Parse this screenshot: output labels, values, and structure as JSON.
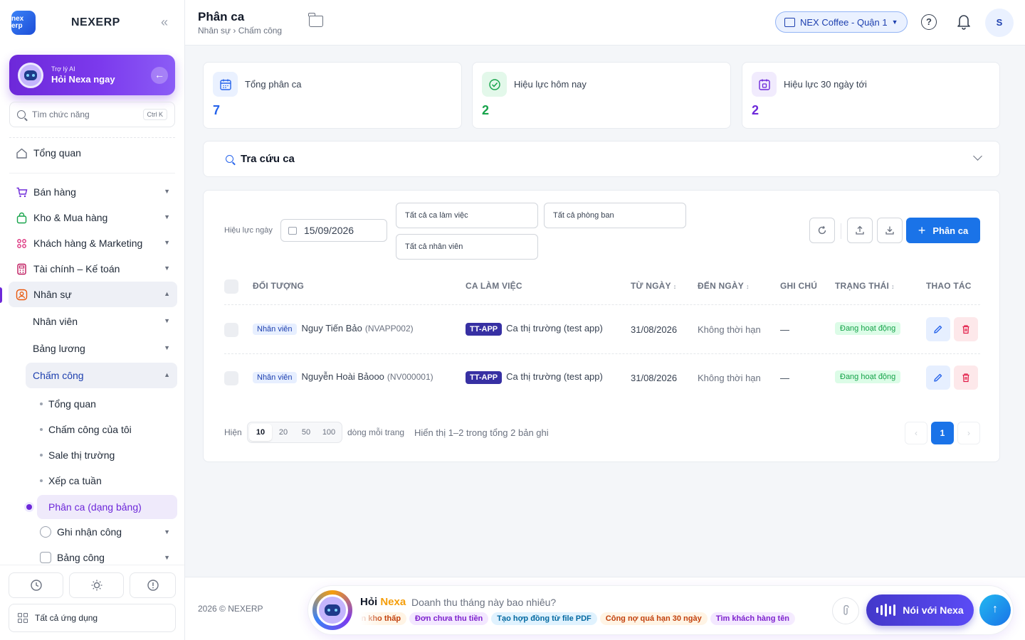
{
  "sidebar": {
    "brand_logo_text": "nex erp",
    "brand_name": "NEXERP",
    "collapse_icon": "«",
    "ai": {
      "sub": "Trợ lý AI",
      "title": "Hỏi Nexa ngay"
    },
    "search": {
      "placeholder": "Tìm chức năng",
      "shortcut": "Ctrl K"
    },
    "overview": "Tổng quan",
    "sections": [
      {
        "label": "Bán hàng",
        "icon": "cart-icon"
      },
      {
        "label": "Kho & Mua hàng",
        "icon": "bag-icon"
      },
      {
        "label": "Khách hàng & Marketing",
        "icon": "users-icon"
      },
      {
        "label": "Tài chính – Kế toán",
        "icon": "calculator-icon"
      },
      {
        "label": "Nhân sự",
        "icon": "person-icon"
      }
    ],
    "hr_children": [
      {
        "label": "Nhân viên"
      },
      {
        "label": "Bảng lương"
      },
      {
        "label": "Chấm công"
      }
    ],
    "attendance_children": [
      {
        "label": "Tổng quan"
      },
      {
        "label": "Chấm công của tôi"
      },
      {
        "label": "Sale thị trường"
      },
      {
        "label": "Xếp ca tuần"
      },
      {
        "label": "Phân ca (dạng bảng)"
      }
    ],
    "extra_children": [
      {
        "label": "Ghi nhận công",
        "icon": "clock-icon"
      },
      {
        "label": "Bảng công",
        "icon": "sheet-icon"
      }
    ],
    "footer": {
      "all_apps": "Tất cả ứng dụng"
    }
  },
  "header": {
    "title": "Phân ca",
    "breadcrumb": "Nhân sự › Chấm công",
    "store": "NEX Coffee - Quận 1",
    "help": "?",
    "avatar": "S"
  },
  "stats": [
    {
      "label": "Tổng phân ca",
      "value": "7",
      "color": "#2563eb"
    },
    {
      "label": "Hiệu lực hôm nay",
      "value": "2",
      "color": "#16a34a"
    },
    {
      "label": "Hiệu lực 30 ngày tới",
      "value": "2",
      "color": "#6d28d9"
    }
  ],
  "lookup": {
    "title": "Tra cứu ca"
  },
  "filters": {
    "date_label": "Hiệu lực ngày",
    "date_value": "15/09/2026",
    "shift": "Tất cả ca làm việc",
    "department": "Tất cả phòng ban",
    "employee": "Tất cả nhân viên",
    "add_label": "Phân ca"
  },
  "table": {
    "columns": [
      "ĐỐI TƯỢNG",
      "CA LÀM VIỆC",
      "TỪ NGÀY",
      "ĐẾN NGÀY",
      "GHI CHÚ",
      "TRẠNG THÁI",
      "THAO TÁC"
    ],
    "rows": [
      {
        "type": "Nhân viên",
        "name": "Nguy Tiến Bảo",
        "code": "(NVAPP002)",
        "shift_code": "TT-APP",
        "shift_name": "Ca thị trường (test app)",
        "from": "31/08/2026",
        "to": "Không thời hạn",
        "note": "—",
        "status": "Đang hoạt động"
      },
      {
        "type": "Nhân viên",
        "name": "Nguyễn Hoài Bảooo",
        "code": "(NV000001)",
        "shift_code": "TT-APP",
        "shift_name": "Ca thị trường (test app)",
        "from": "31/08/2026",
        "to": "Không thời hạn",
        "note": "—",
        "status": "Đang hoạt động"
      }
    ]
  },
  "pagination": {
    "show_label": "Hiện",
    "sizes": [
      "10",
      "20",
      "50",
      "100"
    ],
    "selected_size": "10",
    "per_page_label": "dòng mỗi trang",
    "summary": "Hiển thị 1–2 trong tổng 2 bản ghi",
    "prev": "‹",
    "current_page": "1",
    "next": "›"
  },
  "footer": {
    "copyright": "2026 © NEXERP",
    "ask_prefix": "Hỏi ",
    "ask_brand": "Nexa",
    "ask_placeholder": "Doanh thu tháng này bao nhiêu?",
    "chips": [
      "Tồn kho thấp",
      "Đơn chưa thu tiền",
      "Tạo hợp đồng từ file PDF",
      "Công nợ quá hạn 30 ngày",
      "Tìm khách hàng tên"
    ],
    "voice_label": "Nói với Nexa",
    "send": "↑"
  }
}
